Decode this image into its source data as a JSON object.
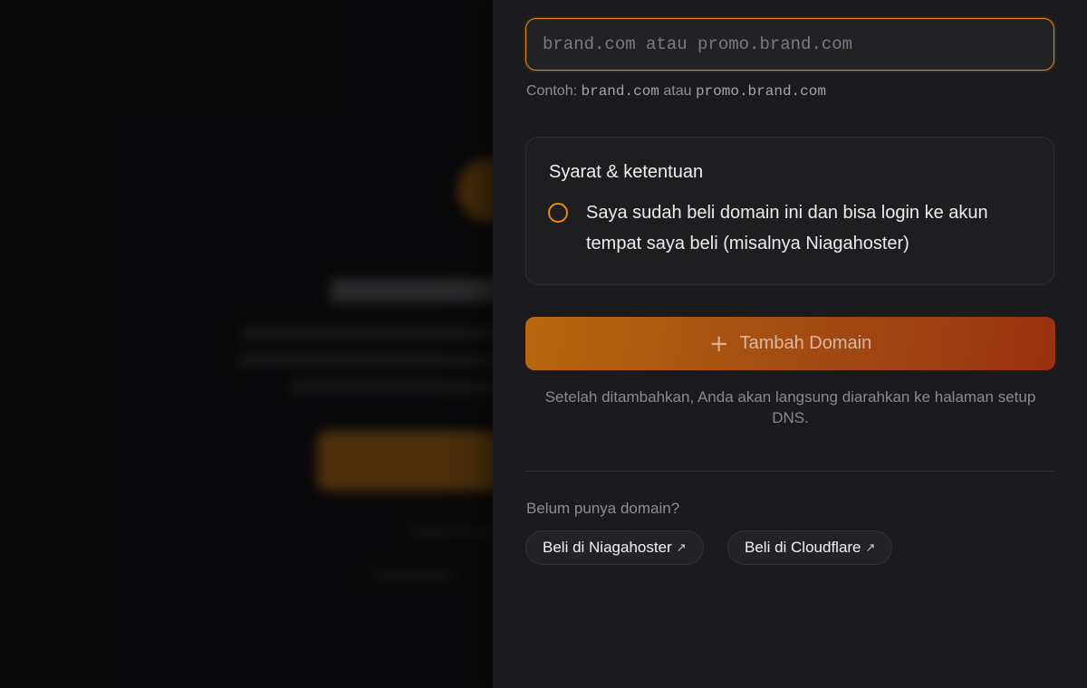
{
  "form": {
    "domain_placeholder": "brand.com atau promo.brand.com",
    "domain_value": "",
    "hint_prefix": "Contoh: ",
    "hint_example1": "brand.com",
    "hint_sep": " atau ",
    "hint_example2": "promo.brand.com"
  },
  "terms": {
    "title": "Syarat & ketentuan",
    "checkbox_label": "Saya sudah beli domain ini dan bisa login ke akun tempat saya beli (misalnya Niagahoster)",
    "checked": false
  },
  "actions": {
    "add_icon": "plus-icon",
    "add_label": "Tambah Domain",
    "after_note": "Setelah ditambahkan, Anda akan langsung diarahkan ke halaman setup DNS."
  },
  "buy": {
    "prompt": "Belum punya domain?",
    "links": [
      {
        "label": "Beli di Niagahoster",
        "icon": "external-link-icon"
      },
      {
        "label": "Beli di Cloudflare",
        "icon": "external-link-icon"
      }
    ]
  },
  "colors": {
    "accent": "#e58b12",
    "panel_bg": "#1b1b1d",
    "button_gradient_start": "#b8670f",
    "button_gradient_end": "#9a3210"
  }
}
